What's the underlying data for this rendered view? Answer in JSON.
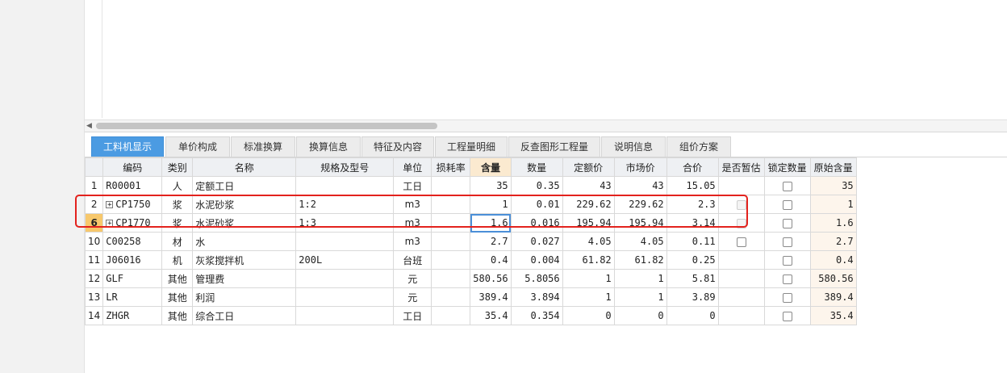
{
  "tabs": [
    {
      "label": "工料机显示",
      "active": true
    },
    {
      "label": "单价构成",
      "active": false
    },
    {
      "label": "标准换算",
      "active": false
    },
    {
      "label": "换算信息",
      "active": false
    },
    {
      "label": "特征及内容",
      "active": false
    },
    {
      "label": "工程量明细",
      "active": false
    },
    {
      "label": "反查图形工程量",
      "active": false
    },
    {
      "label": "说明信息",
      "active": false
    },
    {
      "label": "组价方案",
      "active": false
    }
  ],
  "table": {
    "headers": [
      "",
      "编码",
      "类别",
      "名称",
      "规格及型号",
      "单位",
      "损耗率",
      "含量",
      "数量",
      "定额价",
      "市场价",
      "合价",
      "是否暂估",
      "锁定数量",
      "原始含量"
    ],
    "rows": [
      {
        "no": "1",
        "code": "R00001",
        "type": "人",
        "name": "定额工日",
        "spec": "",
        "unit": "工日",
        "loss": "",
        "qty": "35",
        "amount": "0.35",
        "quota": "43",
        "market": "43",
        "total": "15.05",
        "orig": "35"
      },
      {
        "no": "2",
        "code": "CP1750",
        "type": "浆",
        "name": "水泥砂浆",
        "spec": "1:2",
        "unit": "m3",
        "loss": "",
        "qty": "1",
        "amount": "0.01",
        "quota": "229.62",
        "market": "229.62",
        "total": "2.3",
        "orig": "1"
      },
      {
        "no": "6",
        "code": "CP1770",
        "type": "浆",
        "name": "水泥砂浆",
        "spec": "1:3",
        "unit": "m3",
        "loss": "",
        "qty": "1.6",
        "amount": "0.016",
        "quota": "195.94",
        "market": "195.94",
        "total": "3.14",
        "orig": "1.6"
      },
      {
        "no": "10",
        "code": "C00258",
        "type": "材",
        "name": "水",
        "spec": "",
        "unit": "m3",
        "loss": "",
        "qty": "2.7",
        "amount": "0.027",
        "quota": "4.05",
        "market": "4.05",
        "total": "0.11",
        "orig": "2.7"
      },
      {
        "no": "11",
        "code": "J06016",
        "type": "机",
        "name": "灰浆搅拌机",
        "spec": "200L",
        "unit": "台班",
        "loss": "",
        "qty": "0.4",
        "amount": "0.004",
        "quota": "61.82",
        "market": "61.82",
        "total": "0.25",
        "orig": "0.4"
      },
      {
        "no": "12",
        "code": "GLF",
        "type": "其他",
        "name": "管理费",
        "spec": "",
        "unit": "元",
        "loss": "",
        "qty": "580.56",
        "amount": "5.8056",
        "quota": "1",
        "market": "1",
        "total": "5.81",
        "orig": "580.56"
      },
      {
        "no": "13",
        "code": "LR",
        "type": "其他",
        "name": "利润",
        "spec": "",
        "unit": "元",
        "loss": "",
        "qty": "389.4",
        "amount": "3.894",
        "quota": "1",
        "market": "1",
        "total": "3.89",
        "orig": "389.4"
      },
      {
        "no": "14",
        "code": "ZHGR",
        "type": "其他",
        "name": "综合工日",
        "spec": "",
        "unit": "工日",
        "loss": "",
        "qty": "35.4",
        "amount": "0.354",
        "quota": "0",
        "market": "0",
        "total": "0",
        "orig": "35.4"
      }
    ]
  },
  "colors": {
    "active_tab": "#4b9be2",
    "highlight": "#e3221d",
    "selected_row": "#f7c86c"
  }
}
